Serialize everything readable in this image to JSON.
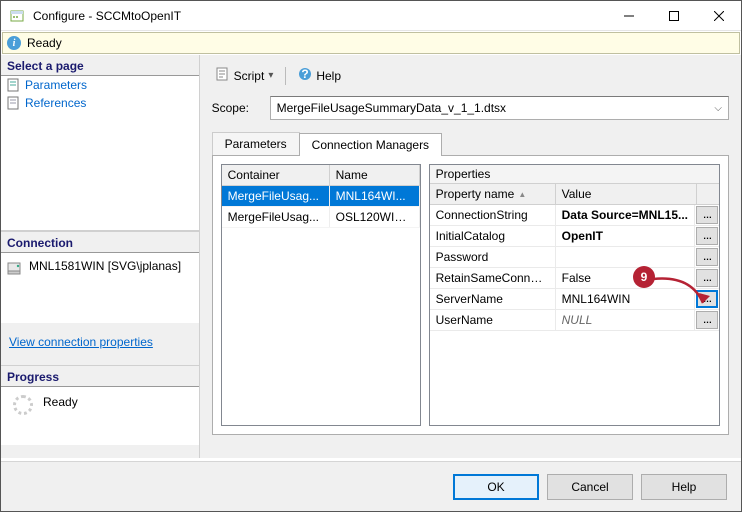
{
  "window": {
    "title": "Configure - SCCMtoOpenIT"
  },
  "status": {
    "text": "Ready"
  },
  "left": {
    "pages_header": "Select a page",
    "pages": [
      {
        "label": "Parameters"
      },
      {
        "label": "References"
      }
    ],
    "connection_header": "Connection",
    "connection_value": "MNL1581WIN [SVG\\jplanas]",
    "link": "View connection properties",
    "progress_header": "Progress",
    "progress_text": "Ready"
  },
  "toolbar": {
    "script": "Script",
    "help": "Help"
  },
  "scope": {
    "label": "Scope:",
    "value": "MergeFileUsageSummaryData_v_1_1.dtsx"
  },
  "tabs": {
    "parameters": "Parameters",
    "connmgr": "Connection Managers"
  },
  "conn_grid": {
    "headers": {
      "container": "Container",
      "name": "Name"
    },
    "rows": [
      {
        "container": "MergeFileUsag...",
        "name": "MNL164WI..."
      },
      {
        "container": "MergeFileUsag...",
        "name": "OSL120WIN...."
      }
    ]
  },
  "properties": {
    "title": "Properties",
    "headers": {
      "name": "Property name",
      "value": "Value"
    },
    "rows": [
      {
        "name": "ConnectionString",
        "value": "Data Source=MNL15...",
        "bold": true
      },
      {
        "name": "InitialCatalog",
        "value": "OpenIT",
        "bold": true
      },
      {
        "name": "Password",
        "value": ""
      },
      {
        "name": "RetainSameConnec...",
        "value": "False"
      },
      {
        "name": "ServerName",
        "value": "MNL164WIN",
        "focused": true
      },
      {
        "name": "UserName",
        "value": "NULL",
        "italic": true
      }
    ]
  },
  "buttons": {
    "ok": "OK",
    "cancel": "Cancel",
    "help": "Help"
  },
  "callout": {
    "number": "9"
  }
}
